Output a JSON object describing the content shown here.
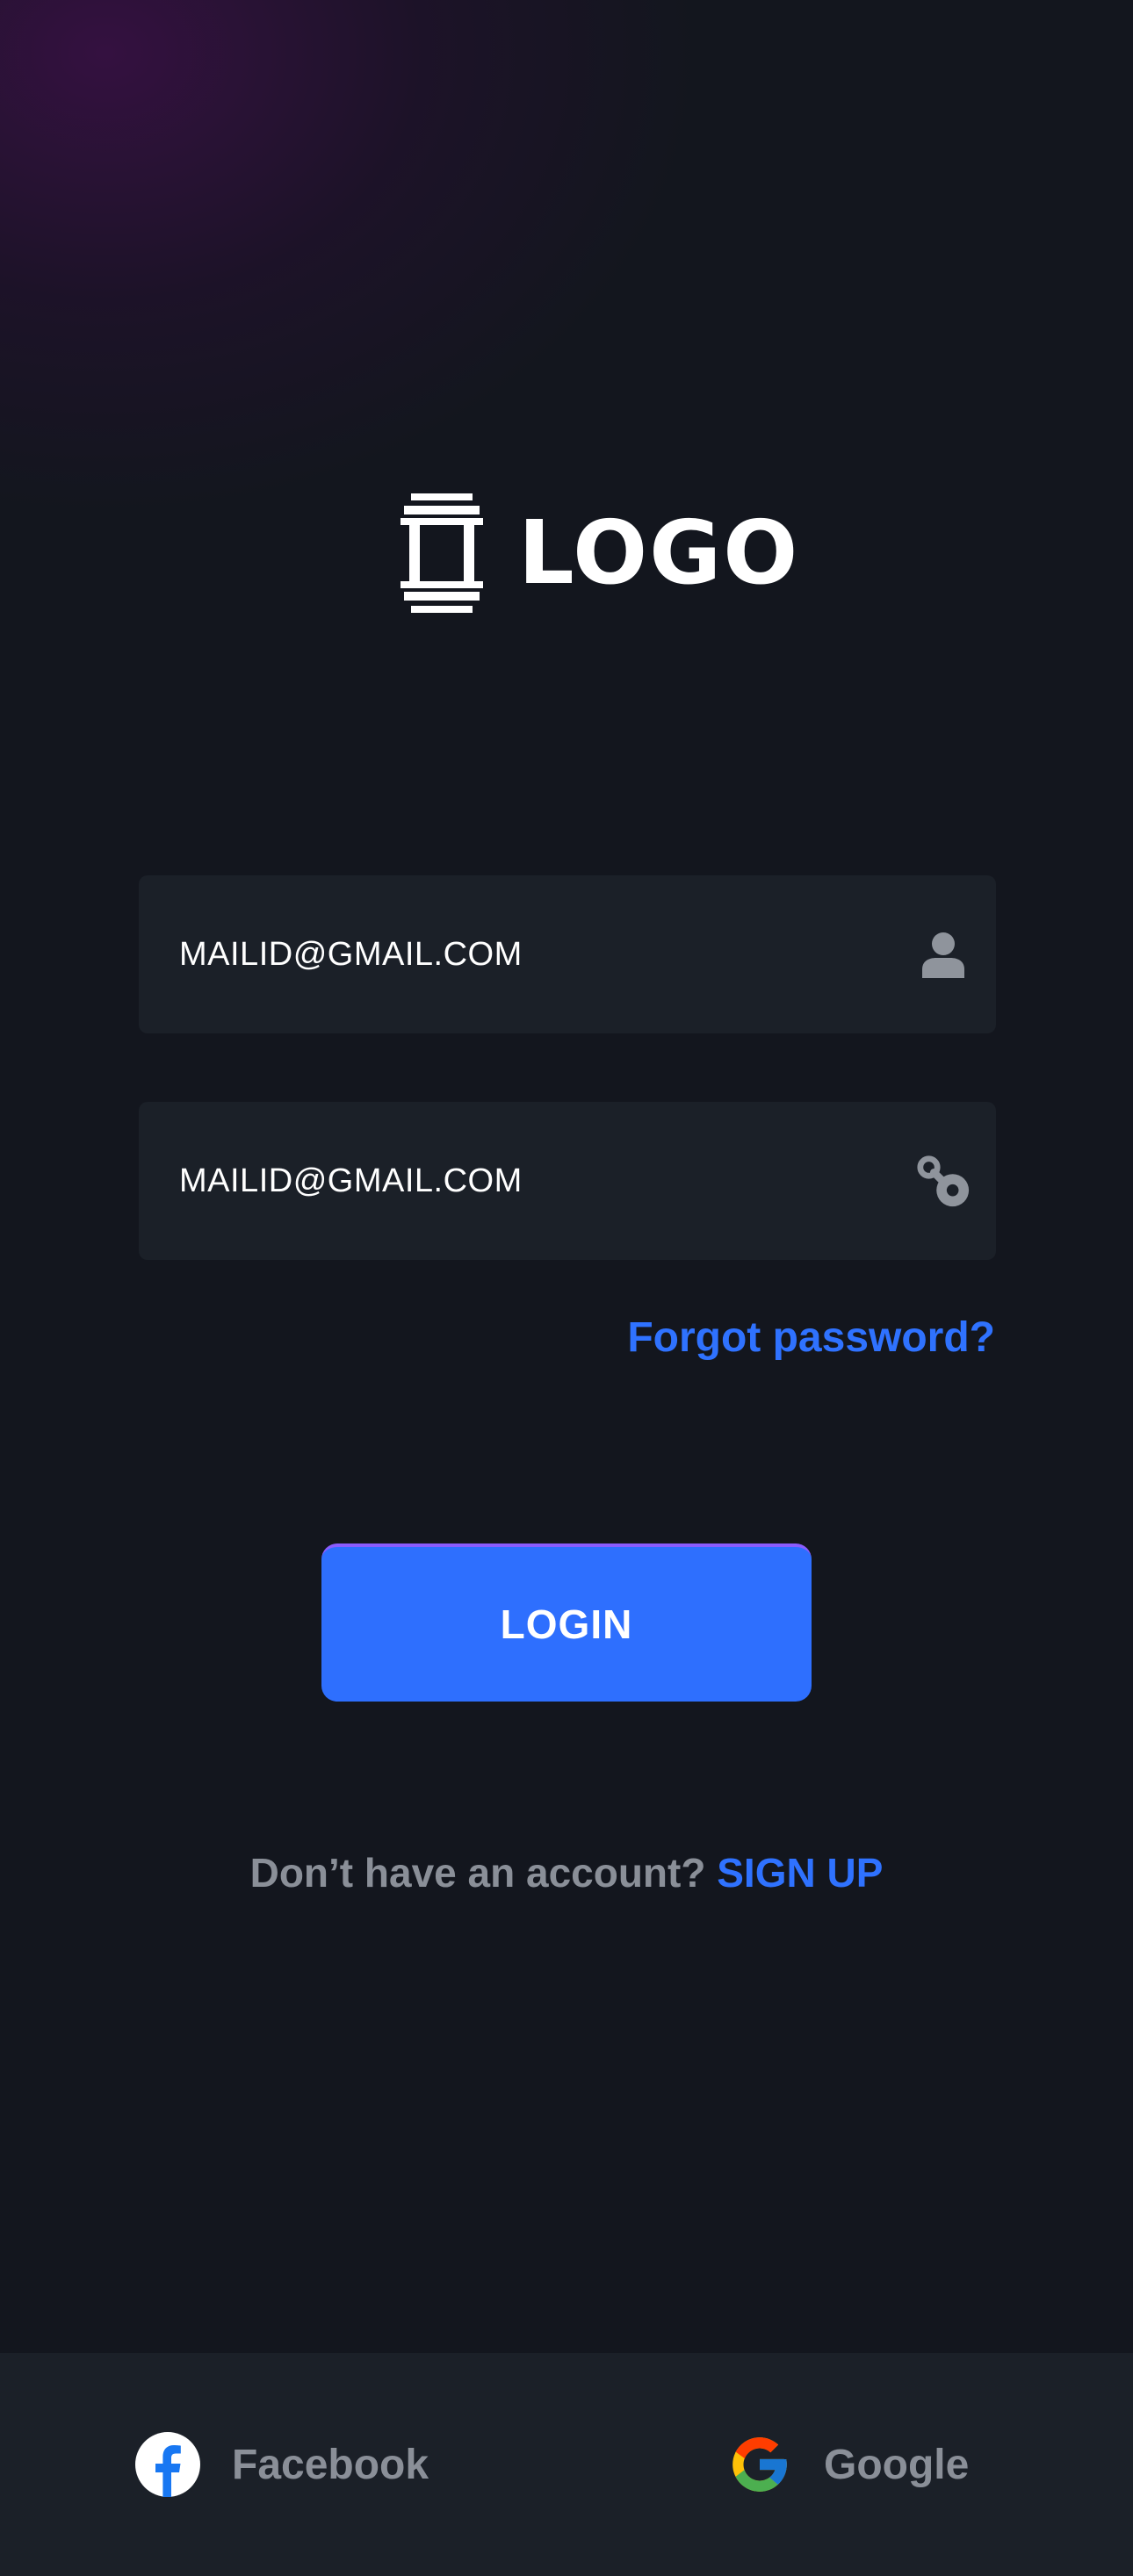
{
  "brand": {
    "logo_text": "LOGO",
    "logo_icon": "pillar-logo-icon"
  },
  "form": {
    "email": {
      "value": "MAILID@GMAIL.COM",
      "icon": "user-icon"
    },
    "password": {
      "value": "MAILID@GMAIL.COM",
      "icon": "key-icon"
    },
    "forgot_password": "Forgot password?",
    "login_label": "LOGIN"
  },
  "signup": {
    "prompt": "Don’t  have an account?",
    "link": "SIGN UP"
  },
  "social": {
    "facebook_label": "Facebook",
    "google_label": "Google"
  },
  "colors": {
    "background": "#13161e",
    "field_background": "#1b2028",
    "accent": "#2e6ffe",
    "muted_text": "#8a8f98"
  }
}
